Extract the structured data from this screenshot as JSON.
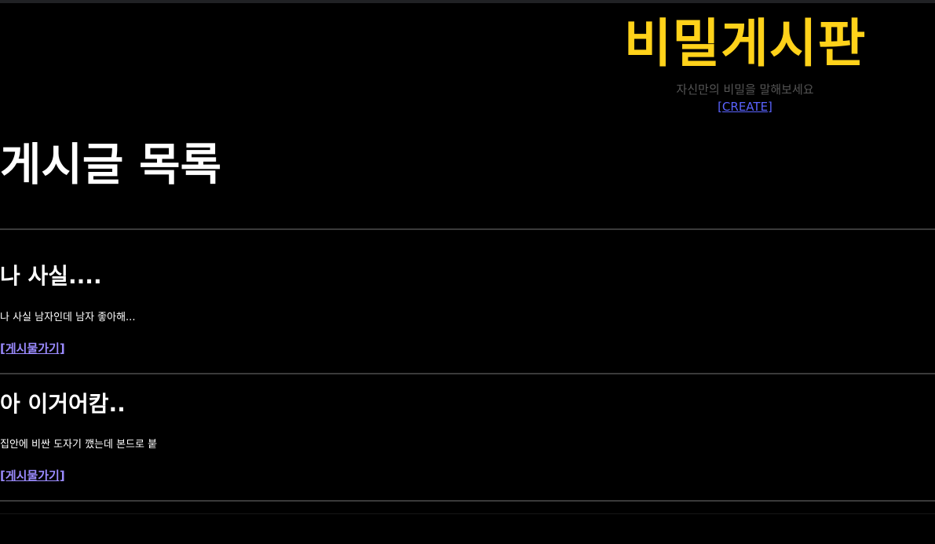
{
  "header": {
    "title": "비밀게시판",
    "subtitle": "자신만의 비밀을 말해보세요",
    "create_label": "[CREATE]"
  },
  "main": {
    "heading": "게시글 목록",
    "posts": [
      {
        "title": "나 사실....",
        "body": "나 사실 남자인데 남자 좋아해...",
        "link_label": "[게시물가기]"
      },
      {
        "title": "아 이거어캄..",
        "body": "집안에 비싼 도자기 깼는데 본드로 붙",
        "link_label": "[게시물가기]"
      }
    ]
  },
  "colors": {
    "background": "#000000",
    "title": "#ffd21a",
    "subtitle": "#555555",
    "create_link": "#5a63ff",
    "post_link": "#9b8bff",
    "divider": "#3a3a3a"
  }
}
